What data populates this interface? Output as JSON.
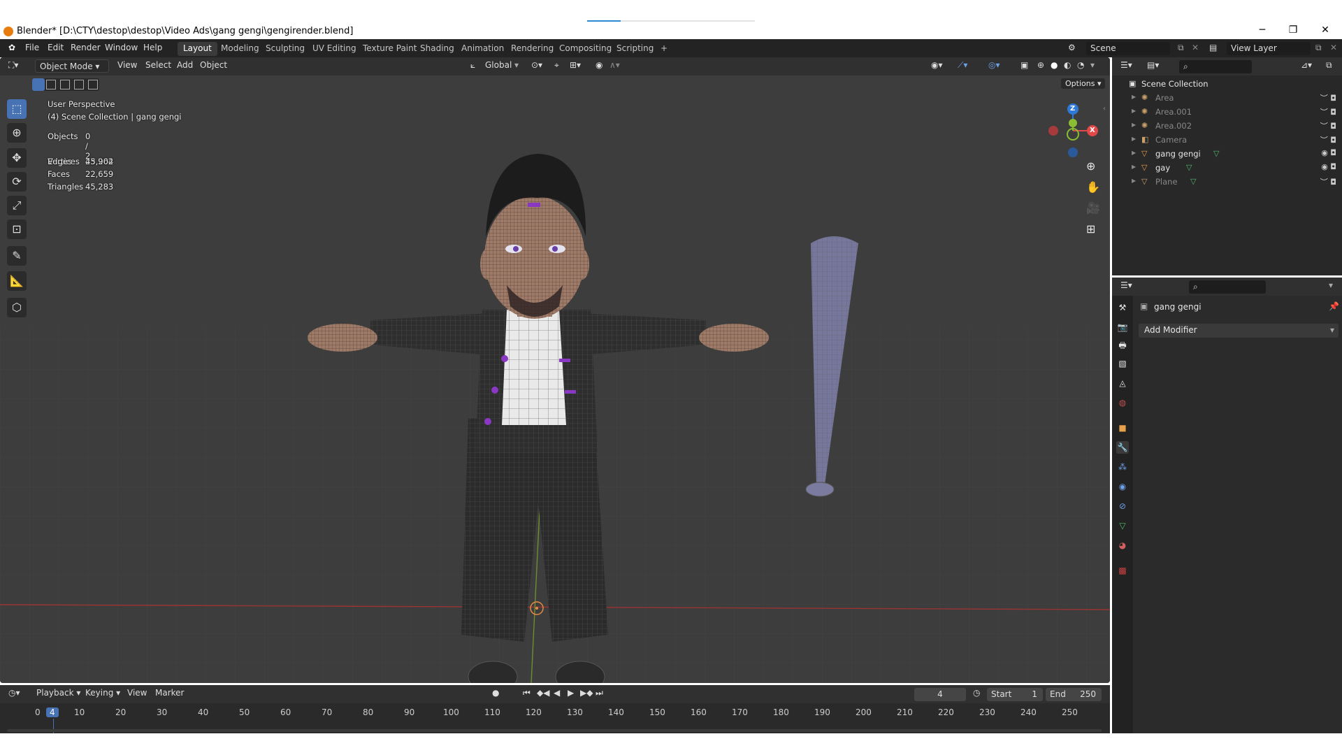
{
  "window": {
    "title": "Blender* [D:\\CTY\\destop\\destop\\Video Ads\\gang gengi\\gengirender.blend]",
    "minimize": "─",
    "maximize": "❐",
    "close": "✕"
  },
  "menu": [
    "File",
    "Edit",
    "Render",
    "Window",
    "Help"
  ],
  "workspaces": [
    "Layout",
    "Modeling",
    "Sculpting",
    "UV Editing",
    "Texture Paint",
    "Shading",
    "Animation",
    "Rendering",
    "Compositing",
    "Scripting",
    "+"
  ],
  "active_workspace": "Layout",
  "scene": {
    "name": "Scene",
    "view_layer": "View Layer"
  },
  "viewport_header": {
    "mode": "Object Mode",
    "menus": [
      "View",
      "Select",
      "Add",
      "Object"
    ],
    "orientation": "Global",
    "options": "Options"
  },
  "viewport_info": {
    "perspective": "User Perspective",
    "collection": "(4) Scene Collection | gang gengi",
    "stats": [
      {
        "label": "Objects",
        "value": "0 / 2"
      },
      {
        "label": "Vertices",
        "value": "23,264"
      },
      {
        "label": "Edges",
        "value": "45,902"
      },
      {
        "label": "Faces",
        "value": "22,659"
      },
      {
        "label": "Triangles",
        "value": "45,283"
      }
    ]
  },
  "gizmo": {
    "z": "Z",
    "y": "Y",
    "x": "X"
  },
  "outliner": {
    "root": "Scene Collection",
    "items": [
      {
        "name": "Area",
        "type": "light",
        "visible": false
      },
      {
        "name": "Area.001",
        "type": "light",
        "visible": false
      },
      {
        "name": "Area.002",
        "type": "light",
        "visible": false
      },
      {
        "name": "Camera",
        "type": "camera",
        "visible": false
      },
      {
        "name": "gang gengi",
        "type": "mesh",
        "visible": true
      },
      {
        "name": "gay",
        "type": "mesh",
        "visible": true
      },
      {
        "name": "Plane",
        "type": "mesh",
        "visible": false
      }
    ]
  },
  "properties": {
    "object_name": "gang gengi",
    "add_modifier": "Add Modifier"
  },
  "timeline": {
    "menus": [
      "Playback",
      "Keying",
      "View",
      "Marker"
    ],
    "current_frame": "4",
    "start_label": "Start",
    "start": "1",
    "end_label": "End",
    "end": "250",
    "ticks": [
      "0",
      "4",
      "10",
      "20",
      "30",
      "40",
      "50",
      "60",
      "70",
      "80",
      "90",
      "100",
      "110",
      "120",
      "130",
      "140",
      "150",
      "160",
      "170",
      "180",
      "190",
      "200",
      "210",
      "220",
      "230",
      "240",
      "250"
    ]
  },
  "colors": {
    "accent": "#4772b3",
    "mesh_icon": "#e8a04a",
    "data_icon": "#52b86c",
    "axis_x": "#e0484a",
    "axis_y": "#8bbd33",
    "axis_z": "#2f79d6"
  }
}
